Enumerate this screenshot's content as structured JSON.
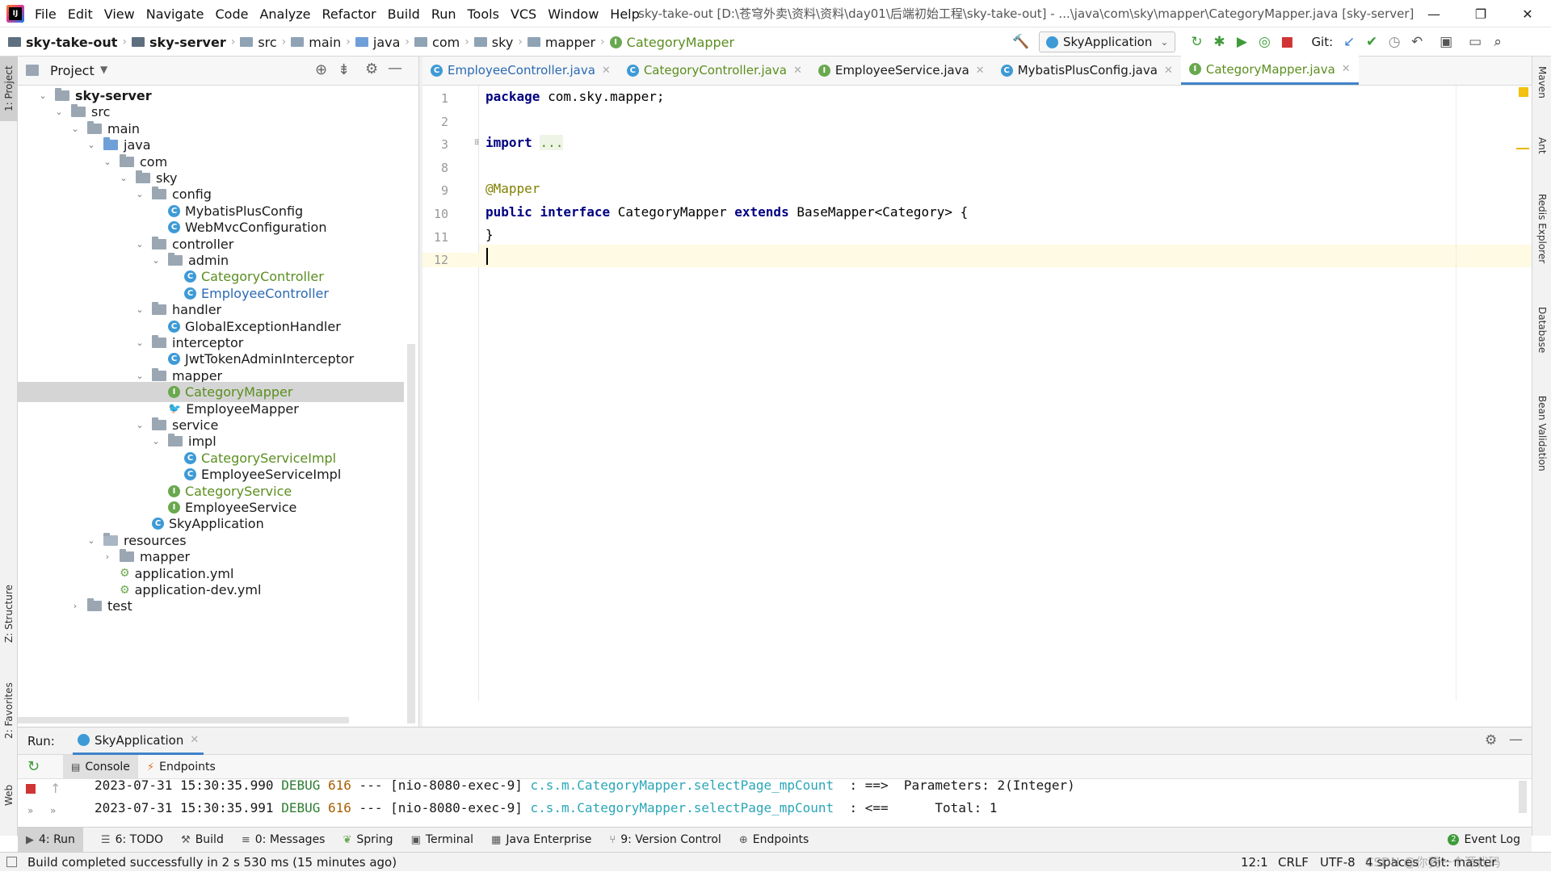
{
  "menubar": {
    "items": [
      "File",
      "Edit",
      "View",
      "Navigate",
      "Code",
      "Analyze",
      "Refactor",
      "Build",
      "Run",
      "Tools",
      "VCS",
      "Window",
      "Help"
    ],
    "window_title": "sky-take-out [D:\\苍穹外卖\\资料\\资料\\day01\\后端初始工程\\sky-take-out] - ...\\java\\com\\sky\\mapper\\CategoryMapper.java [sky-server]"
  },
  "breadcrumbs": [
    "sky-take-out",
    "sky-server",
    "src",
    "main",
    "java",
    "com",
    "sky",
    "mapper",
    "CategoryMapper"
  ],
  "toolbar": {
    "run_config": "SkyApplication",
    "git_label": "Git:"
  },
  "left_strip": {
    "project": "1: Project",
    "structure": "Z: Structure",
    "favorites": "2: Favorites",
    "web": "Web"
  },
  "right_strip": [
    "Maven",
    "Ant",
    "Redis Explorer",
    "Database",
    "Bean Validation"
  ],
  "project_panel": {
    "title": "Project",
    "tree": [
      {
        "label": "sky-server",
        "depth": 0,
        "kind": "module",
        "open": true
      },
      {
        "label": "src",
        "depth": 1,
        "kind": "folder",
        "open": true
      },
      {
        "label": "main",
        "depth": 2,
        "kind": "folder",
        "open": true
      },
      {
        "label": "java",
        "depth": 3,
        "kind": "src",
        "open": true
      },
      {
        "label": "com",
        "depth": 4,
        "kind": "folder",
        "open": true
      },
      {
        "label": "sky",
        "depth": 5,
        "kind": "folder",
        "open": true
      },
      {
        "label": "config",
        "depth": 6,
        "kind": "folder",
        "open": true
      },
      {
        "label": "MybatisPlusConfig",
        "depth": 7,
        "kind": "class"
      },
      {
        "label": "WebMvcConfiguration",
        "depth": 7,
        "kind": "class"
      },
      {
        "label": "controller",
        "depth": 6,
        "kind": "folder",
        "open": true
      },
      {
        "label": "admin",
        "depth": 7,
        "kind": "folder",
        "open": true
      },
      {
        "label": "CategoryController",
        "depth": 8,
        "kind": "class",
        "color": "green"
      },
      {
        "label": "EmployeeController",
        "depth": 8,
        "kind": "class",
        "color": "blue"
      },
      {
        "label": "handler",
        "depth": 6,
        "kind": "folder",
        "open": true
      },
      {
        "label": "GlobalExceptionHandler",
        "depth": 7,
        "kind": "class"
      },
      {
        "label": "interceptor",
        "depth": 6,
        "kind": "folder",
        "open": true
      },
      {
        "label": "JwtTokenAdminInterceptor",
        "depth": 7,
        "kind": "class"
      },
      {
        "label": "mapper",
        "depth": 6,
        "kind": "folder",
        "open": true
      },
      {
        "label": "CategoryMapper",
        "depth": 7,
        "kind": "interface",
        "color": "green",
        "selected": true
      },
      {
        "label": "EmployeeMapper",
        "depth": 7,
        "kind": "mybatis"
      },
      {
        "label": "service",
        "depth": 6,
        "kind": "folder",
        "open": true
      },
      {
        "label": "impl",
        "depth": 7,
        "kind": "folder",
        "open": true
      },
      {
        "label": "CategoryServiceImpl",
        "depth": 8,
        "kind": "class",
        "color": "green"
      },
      {
        "label": "EmployeeServiceImpl",
        "depth": 8,
        "kind": "class"
      },
      {
        "label": "CategoryService",
        "depth": 7,
        "kind": "interface",
        "color": "green"
      },
      {
        "label": "EmployeeService",
        "depth": 7,
        "kind": "interface"
      },
      {
        "label": "SkyApplication",
        "depth": 6,
        "kind": "app"
      },
      {
        "label": "resources",
        "depth": 3,
        "kind": "res",
        "open": true
      },
      {
        "label": "mapper",
        "depth": 4,
        "kind": "folder",
        "open": false
      },
      {
        "label": "application.yml",
        "depth": 4,
        "kind": "yml"
      },
      {
        "label": "application-dev.yml",
        "depth": 4,
        "kind": "yml"
      },
      {
        "label": "test",
        "depth": 2,
        "kind": "folder",
        "open": false
      }
    ]
  },
  "editor": {
    "tabs": [
      {
        "label": "EmployeeController.java",
        "icon": "C",
        "color": "blue"
      },
      {
        "label": "CategoryController.java",
        "icon": "C",
        "color": "green"
      },
      {
        "label": "EmployeeService.java",
        "icon": "I",
        "color": "plain"
      },
      {
        "label": "MybatisPlusConfig.java",
        "icon": "C",
        "color": "plain"
      },
      {
        "label": "CategoryMapper.java",
        "icon": "I",
        "color": "green",
        "active": true
      }
    ],
    "line_numbers": [
      "1",
      "2",
      "3",
      "8",
      "9",
      "10",
      "11",
      "12"
    ],
    "code": {
      "l1_kw": "package",
      "l1_rest": " com.sky.mapper;",
      "l3_kw": "import",
      "l3_fold": "...",
      "l9_ann": "@Mapper",
      "l10_kw1": "public",
      "l10_kw2": "interface",
      "l10_name": " CategoryMapper ",
      "l10_kw3": "extends",
      "l10_rest": " BaseMapper<Category> {",
      "l11": "}"
    }
  },
  "run_panel": {
    "label": "Run:",
    "config_tab": "SkyApplication",
    "subtabs": [
      "Console",
      "Endpoints"
    ],
    "logs": [
      {
        "ts": "2023-07-31 15:30:35.990",
        "level": "DEBUG",
        "pid": "616",
        "sep": " --- ",
        "thread": "[nio-8080-exec-9]",
        "logger": "c.s.m.CategoryMapper.selectPage_mpCount",
        "msg": "  : ==>  Parameters: 2(Integer)"
      },
      {
        "ts": "2023-07-31 15:30:35.991",
        "level": "DEBUG",
        "pid": "616",
        "sep": " --- ",
        "thread": "[nio-8080-exec-9]",
        "logger": "c.s.m.CategoryMapper.selectPage_mpCount",
        "msg": "  : <==      Total: 1"
      }
    ]
  },
  "bottom_tabs": [
    "4: Run",
    "6: TODO",
    "Build",
    "0: Messages",
    "Spring",
    "Terminal",
    "Java Enterprise",
    "9: Version Control",
    "Endpoints"
  ],
  "event_log": {
    "count": "2",
    "label": "Event Log"
  },
  "status": {
    "message": "Build completed successfully in 2 s 530 ms (15 minutes ago)",
    "position": "12:1",
    "line_sep": "CRLF",
    "encoding": "UTF-8",
    "indent": "4 spaces",
    "git": "Git: master",
    "watermark": "CSDN @你我一个源代码"
  }
}
